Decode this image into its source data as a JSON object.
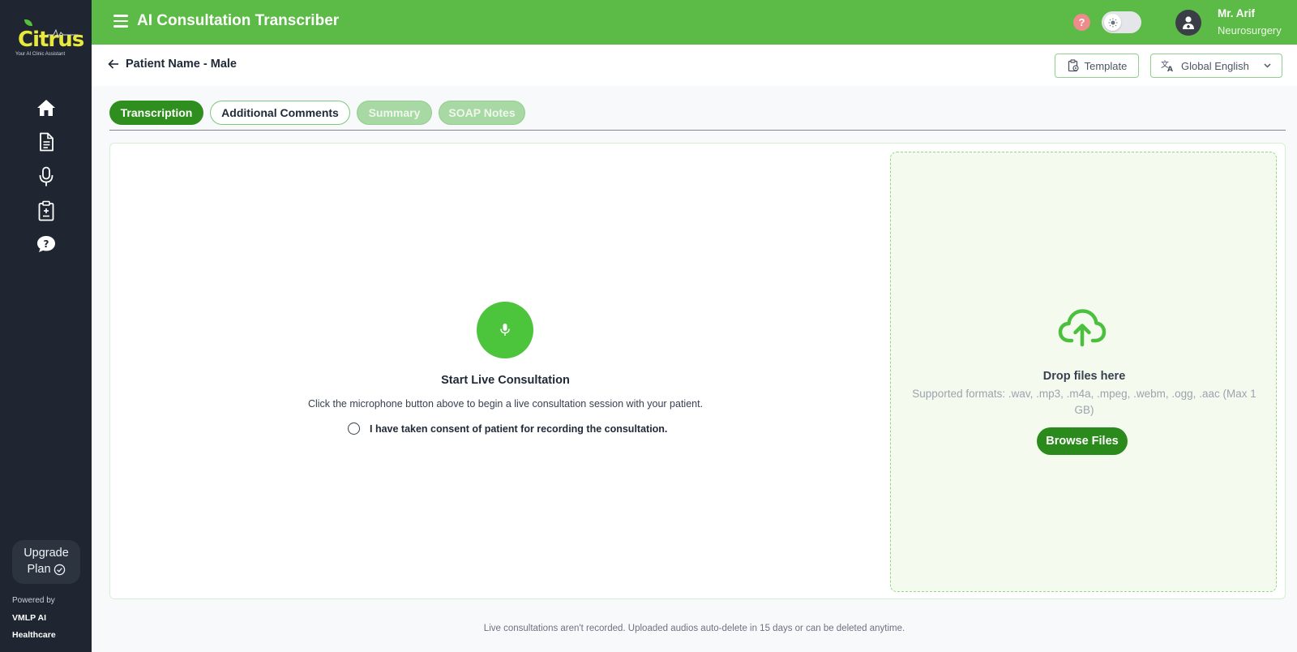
{
  "brand": {
    "logo_text": "Citrus",
    "tagline": "Your AI Clinic Assistant",
    "primary_color": "#5cba46",
    "dark_green": "#2f8f1e",
    "sidebar_color": "#1f2631"
  },
  "sidebar": {
    "items": [
      {
        "name": "home",
        "icon": "home-icon"
      },
      {
        "name": "documents",
        "icon": "document-icon"
      },
      {
        "name": "microphone",
        "icon": "microphone-icon"
      },
      {
        "name": "clipboard",
        "icon": "clipboard-icon"
      },
      {
        "name": "help",
        "icon": "help-chat-icon"
      }
    ],
    "upgrade_line1": "Upgrade",
    "upgrade_line2": "Plan",
    "powered_by": "Powered by",
    "company_line1": "VMLP AI",
    "company_line2": "Healthcare"
  },
  "header": {
    "title": "AI Consultation Transcriber",
    "help_label": "?",
    "user_name": "Mr. Arif",
    "user_department": "Neurosurgery"
  },
  "subheader": {
    "patient_label": "Patient Name - Male",
    "template_label": "Template",
    "language_selected": "Global English"
  },
  "tabs": [
    {
      "label": "Transcription",
      "state": "active"
    },
    {
      "label": "Additional Comments",
      "state": "enabled"
    },
    {
      "label": "Summary",
      "state": "disabled"
    },
    {
      "label": "SOAP Notes",
      "state": "disabled"
    }
  ],
  "live": {
    "title": "Start Live Consultation",
    "description": "Click the microphone button above to begin a live consultation session with your patient.",
    "consent_label": "I have taken consent of patient for recording the consultation."
  },
  "upload": {
    "title": "Drop files here",
    "formats": "Supported formats: .wav, .mp3, .m4a, .mpeg, .webm, .ogg, .aac (Max 1 GB)",
    "browse_label": "Browse Files"
  },
  "footer": {
    "note": "Live consultations aren't recorded. Uploaded audios auto-delete in 15 days or can be deleted anytime."
  }
}
